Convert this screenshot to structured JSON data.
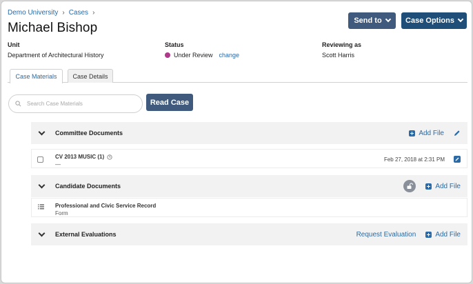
{
  "breadcrumb": {
    "items": [
      "Demo University",
      "Cases"
    ],
    "separator": "›"
  },
  "page": {
    "title": "Michael Bishop"
  },
  "actions": {
    "send_to": "Send to",
    "case_options": "Case Options"
  },
  "meta": {
    "unit_label": "Unit",
    "unit_value": "Department of Architectural History",
    "status_label": "Status",
    "status_value": "Under Review",
    "status_change": "change",
    "reviewer_label": "Reviewing as",
    "reviewer_value": "Scott Harris"
  },
  "tabs": [
    {
      "label": "Case Materials",
      "active": true
    },
    {
      "label": "Case Details",
      "active": false
    }
  ],
  "search": {
    "placeholder": "Search Case Materials"
  },
  "read_case": "Read Case",
  "sections": [
    {
      "title": "Committee Documents",
      "add_file": "Add File",
      "files": [
        {
          "name": "CV 2013 MUSIC (1)",
          "sub": "—",
          "date": "Feb 27, 2018 at 2:31 PM"
        }
      ]
    },
    {
      "title": "Candidate Documents",
      "add_file": "Add File",
      "files": [
        {
          "name": "Professional and Civic Service Record",
          "sub": "Form"
        }
      ]
    },
    {
      "title": "External Evaluations",
      "request_evaluation": "Request Evaluation",
      "add_file": "Add File"
    }
  ],
  "colors": {
    "link": "#2b6aa6",
    "button_dark": "#3f5a7d",
    "button_primary": "#1f4e79",
    "status_dot": "#b03a8a"
  }
}
